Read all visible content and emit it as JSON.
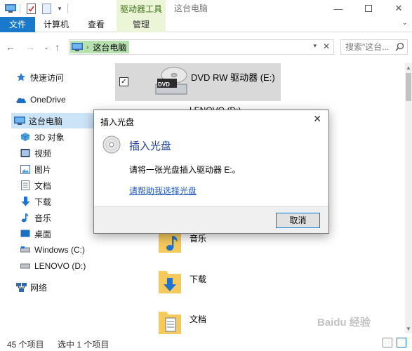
{
  "titlebar": {
    "tool_tab": "驱动器工具",
    "window_title": "这台电脑"
  },
  "ribbon": {
    "tabs": [
      "文件",
      "计算机",
      "查看",
      "管理"
    ]
  },
  "address": {
    "path": "这台电脑",
    "search_placeholder": "搜索\"这台..."
  },
  "sidebar": {
    "items": [
      {
        "label": "快速访问",
        "icon": "star-icon"
      },
      {
        "label": "OneDrive",
        "icon": "cloud-icon"
      },
      {
        "label": "这台电脑",
        "icon": "computer-icon"
      },
      {
        "label": "3D 对象",
        "icon": "cube-icon"
      },
      {
        "label": "视频",
        "icon": "video-icon"
      },
      {
        "label": "图片",
        "icon": "picture-icon"
      },
      {
        "label": "文档",
        "icon": "document-icon"
      },
      {
        "label": "下载",
        "icon": "download-icon"
      },
      {
        "label": "音乐",
        "icon": "music-icon"
      },
      {
        "label": "桌面",
        "icon": "desktop-icon"
      },
      {
        "label": "Windows (C:)",
        "icon": "drive-icon"
      },
      {
        "label": "LENOVO (D:)",
        "icon": "drive-icon"
      },
      {
        "label": "网络",
        "icon": "network-icon"
      }
    ]
  },
  "main": {
    "selected_drive": "DVD RW 驱动器 (E:)",
    "drive_badge": "DVD",
    "peek_drive": "LENOVO (D:)",
    "folders": [
      "音乐",
      "下载",
      "文档"
    ]
  },
  "status": {
    "count": "45 个项目",
    "selected": "选中 1 个项目"
  },
  "dialog": {
    "title": "插入光盘",
    "heading": "插入光盘",
    "message": "请将一张光盘插入驱动器 E:。",
    "link": "请帮助我选择光盘",
    "cancel": "取消"
  },
  "watermark": "Baidu 经验",
  "colors": {
    "accent": "#1979ca",
    "tool_tab_bg": "#ecf5d8",
    "selection": "#cce4f7",
    "address_highlight": "#b8e1b0",
    "dialog_heading": "#1c3fa0"
  }
}
